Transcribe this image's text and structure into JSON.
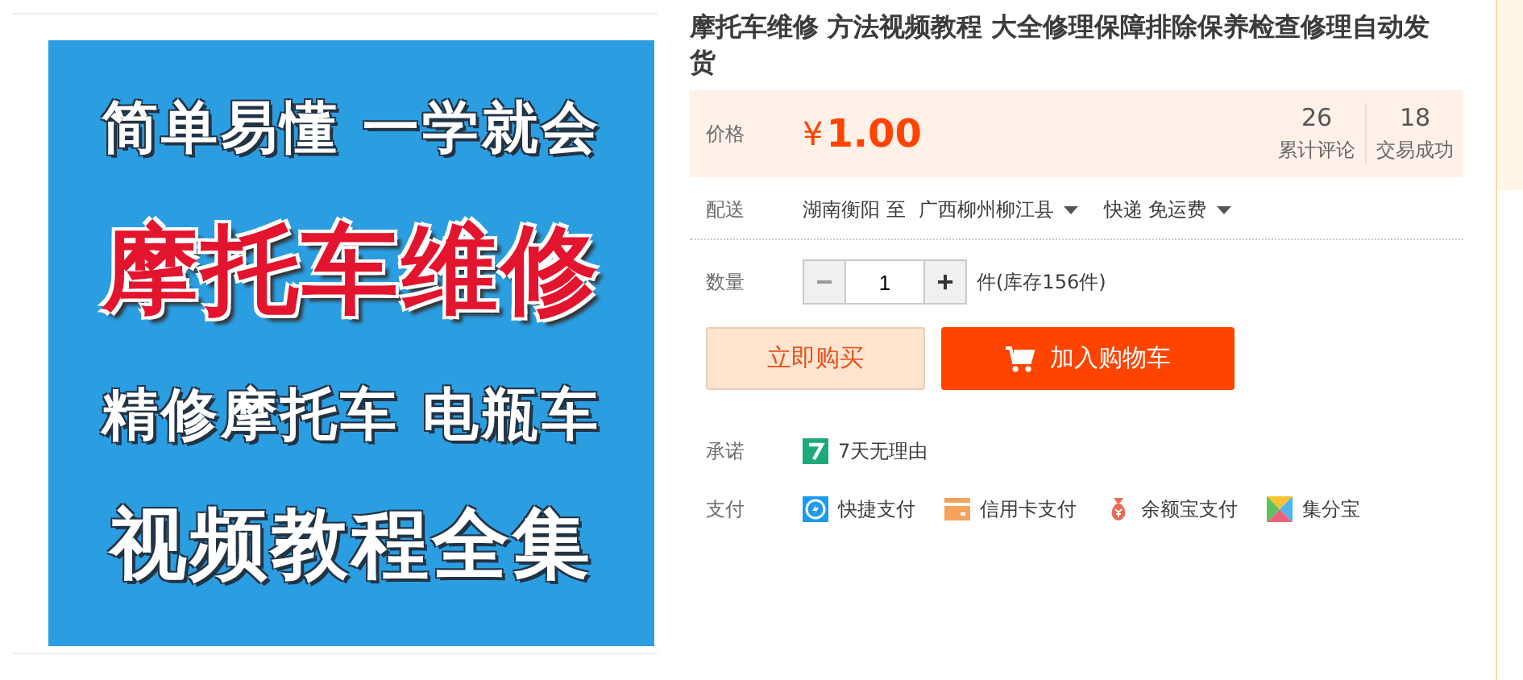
{
  "product_image": {
    "lines": [
      {
        "text": "简单易懂 一学就会",
        "kind": "white"
      },
      {
        "text": "摩托车维修",
        "kind": "red"
      },
      {
        "text": "精修摩托车 电瓶车",
        "kind": "white"
      },
      {
        "text": "视频教程全集",
        "kind": "large"
      }
    ]
  },
  "title": "摩托车维修 方法视频教程 大全修理保障排除保养检查修理自动发货",
  "price": {
    "label": "价格",
    "currency": "¥",
    "value": "1.00"
  },
  "stats": [
    {
      "value": "26",
      "label": "累计评论"
    },
    {
      "value": "18",
      "label": "交易成功"
    }
  ],
  "delivery": {
    "label": "配送",
    "from": "湖南衡阳 至",
    "to": "广西柳州柳江县",
    "shipping": "快递 免运费"
  },
  "quantity": {
    "label": "数量",
    "minus": "−",
    "value": "1",
    "plus": "+",
    "stock": "件(库存156件)",
    "minus_disabled": true
  },
  "buttons": [
    {
      "label": "立即购买",
      "kind": "buy"
    },
    {
      "label": "加入购物车",
      "kind": "cart"
    }
  ],
  "promise": {
    "label": "承诺",
    "items": [
      {
        "text": "7天无理由",
        "kind": "seven"
      }
    ]
  },
  "payment": {
    "label": "支付",
    "items": [
      {
        "text": "快捷支付",
        "kind": "bolt"
      },
      {
        "text": "信用卡支付",
        "kind": "card"
      },
      {
        "text": "余额宝支付",
        "kind": "bag"
      },
      {
        "text": "集分宝",
        "kind": "tiles"
      }
    ]
  }
}
